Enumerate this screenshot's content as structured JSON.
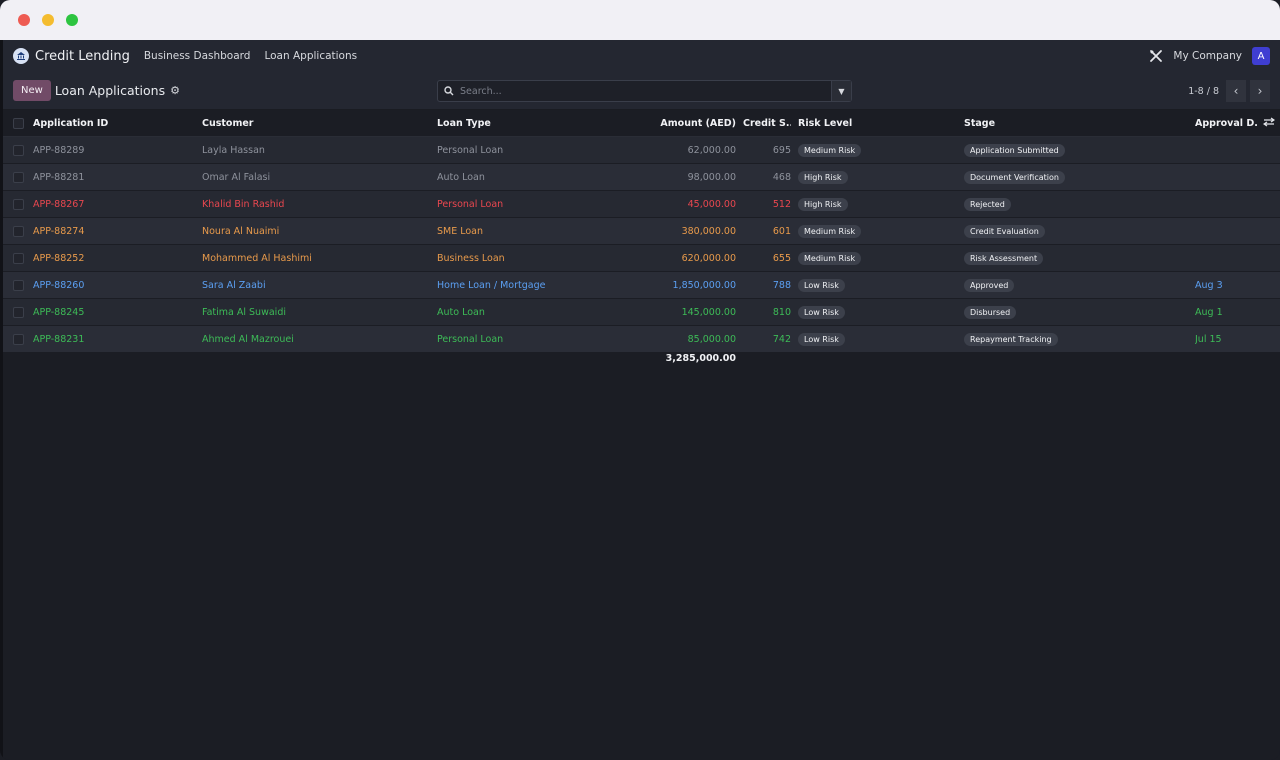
{
  "navbar": {
    "brand": "Credit Lending",
    "links": [
      "Business Dashboard",
      "Loan Applications"
    ],
    "company": "My Company",
    "avatar_letter": "A"
  },
  "control": {
    "new_label": "New",
    "title": "Loan Applications",
    "search_placeholder": "Search...",
    "pager": "1-8 / 8"
  },
  "table": {
    "headers": {
      "id": "Application ID",
      "customer": "Customer",
      "loan_type": "Loan Type",
      "amount": "Amount (AED)",
      "credit_score": "Credit S...",
      "risk": "Risk Level",
      "stage": "Stage",
      "approval": "Approval D..."
    },
    "rows": [
      {
        "id": "APP-88289",
        "customer": "Layla Hassan",
        "loan_type": "Personal Loan",
        "amount": "62,000.00",
        "credit_score": "695",
        "risk": "Medium Risk",
        "stage": "Application Submitted",
        "approval": "",
        "color": "gray"
      },
      {
        "id": "APP-88281",
        "customer": "Omar Al Falasi",
        "loan_type": "Auto Loan",
        "amount": "98,000.00",
        "credit_score": "468",
        "risk": "High Risk",
        "stage": "Document Verification",
        "approval": "",
        "color": "gray"
      },
      {
        "id": "APP-88267",
        "customer": "Khalid Bin Rashid",
        "loan_type": "Personal Loan",
        "amount": "45,000.00",
        "credit_score": "512",
        "risk": "High Risk",
        "stage": "Rejected",
        "approval": "",
        "color": "red"
      },
      {
        "id": "APP-88274",
        "customer": "Noura Al Nuaimi",
        "loan_type": "SME Loan",
        "amount": "380,000.00",
        "credit_score": "601",
        "risk": "Medium Risk",
        "stage": "Credit Evaluation",
        "approval": "",
        "color": "orange"
      },
      {
        "id": "APP-88252",
        "customer": "Mohammed Al Hashimi",
        "loan_type": "Business Loan",
        "amount": "620,000.00",
        "credit_score": "655",
        "risk": "Medium Risk",
        "stage": "Risk Assessment",
        "approval": "",
        "color": "orange"
      },
      {
        "id": "APP-88260",
        "customer": "Sara Al Zaabi",
        "loan_type": "Home Loan / Mortgage",
        "amount": "1,850,000.00",
        "credit_score": "788",
        "risk": "Low Risk",
        "stage": "Approved",
        "approval": "Aug 3",
        "color": "blue"
      },
      {
        "id": "APP-88245",
        "customer": "Fatima Al Suwaidi",
        "loan_type": "Auto Loan",
        "amount": "145,000.00",
        "credit_score": "810",
        "risk": "Low Risk",
        "stage": "Disbursed",
        "approval": "Aug 1",
        "color": "green"
      },
      {
        "id": "APP-88231",
        "customer": "Ahmed Al Mazrouei",
        "loan_type": "Personal Loan",
        "amount": "85,000.00",
        "credit_score": "742",
        "risk": "Low Risk",
        "stage": "Repayment Tracking",
        "approval": "Jul 15",
        "color": "green"
      }
    ],
    "total_amount": "3,285,000.00"
  },
  "colors": {
    "gray": "#8e929c",
    "red": "#e9474f",
    "orange": "#e89a4b",
    "blue": "#5b9ff2",
    "green": "#3dbb57",
    "brand_purple": "#714b67"
  }
}
